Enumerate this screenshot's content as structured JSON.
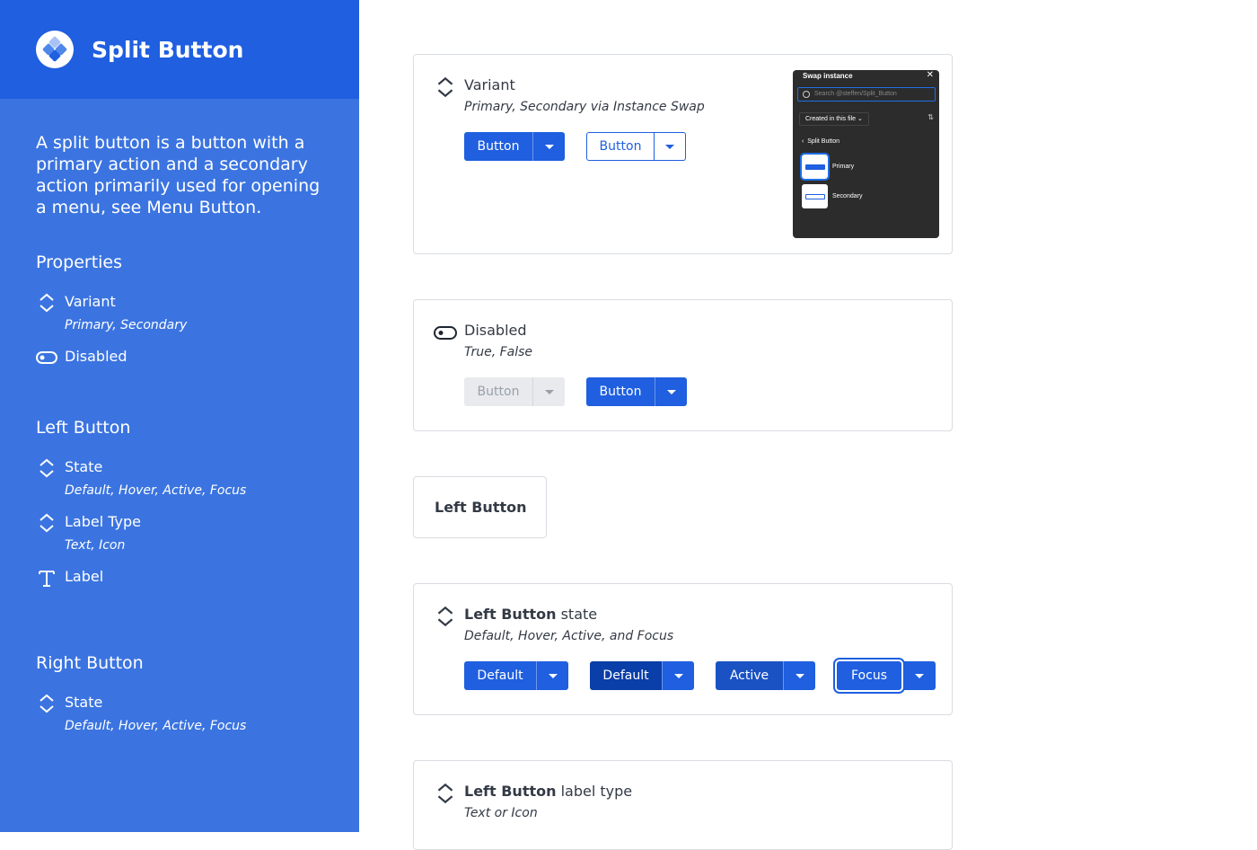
{
  "sidebar": {
    "title": "Split Button",
    "description": "A split button is a button with a primary action and a secondary action primarily used for opening a menu, see Menu Button.",
    "properties": {
      "heading": "Properties",
      "variant": {
        "name": "Variant",
        "values": "Primary, Secondary"
      },
      "disabled": {
        "name": "Disabled"
      }
    },
    "left_button": {
      "heading": "Left Button",
      "state": {
        "name": "State",
        "values": "Default, Hover, Active, Focus"
      },
      "label_type": {
        "name": "Label Type",
        "values": "Text, Icon"
      },
      "label": {
        "name": "Label"
      }
    },
    "right_button": {
      "heading": "Right Button",
      "state": {
        "name": "State",
        "values": "Default, Hover, Active, Focus"
      }
    }
  },
  "cards": {
    "variant": {
      "name": "Variant",
      "values": "Primary, Secondary via Instance Swap",
      "primary_label": "Button",
      "secondary_label": "Button",
      "swap": {
        "title": "Swap instance",
        "close": "✕",
        "search_placeholder": "Search @steffen/Split_Button",
        "filter": "Created in this file",
        "back": "Split Button",
        "items": [
          "Primary",
          "Secondary"
        ]
      }
    },
    "disabled": {
      "name": "Disabled",
      "values": "True, False",
      "disabled_label": "Button",
      "enabled_label": "Button"
    },
    "left_button_title": "Left Button",
    "state": {
      "name_bold": "Left Button",
      "name_rest": " state",
      "values": "Default, Hover, Active, and Focus",
      "labels": [
        "Default",
        "Default",
        "Active",
        "Focus"
      ]
    },
    "label_type": {
      "name_bold": "Left Button",
      "name_rest": " label type",
      "values": "Text or Icon"
    }
  },
  "colors": {
    "primary": "#1f5fe0",
    "sidebar": "#3b74e0",
    "header": "#1f5fe0"
  }
}
